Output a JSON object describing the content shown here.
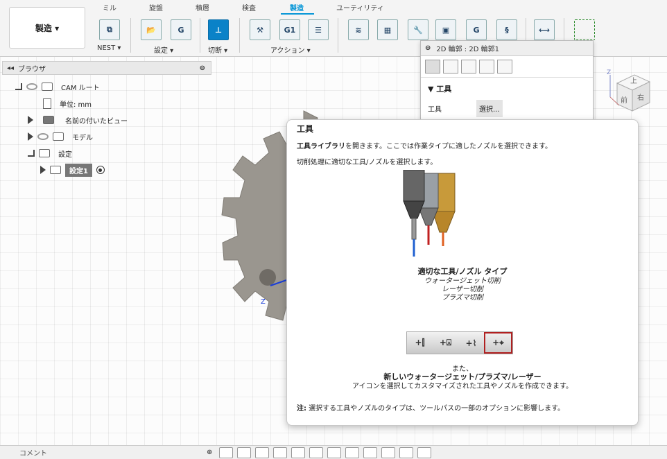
{
  "tabs": [
    "ミル",
    "旋盤",
    "積層",
    "検査",
    "製造",
    "ユーティリティ"
  ],
  "active_tab": "製造",
  "workspace_button": "製造 ▾",
  "toolbar_groups": {
    "nest": "NEST ▾",
    "setup": "設定 ▾",
    "cut": "切断 ▾",
    "action": "アクション ▾"
  },
  "browser": {
    "title": "ブラウザ",
    "items": {
      "cam_root": "CAM ルート",
      "units": "単位: mm",
      "named_views": "名前の付いたビュー",
      "model": "モデル",
      "setups": "設定",
      "setup1": "設定1"
    }
  },
  "dialog": {
    "title": "2D 輪郭 : 2D 輪郭1",
    "section": "工具",
    "tool_label": "工具",
    "select_button": "選択..."
  },
  "tooltip": {
    "title": "工具",
    "line1_bold": "工具ライブラリ",
    "line1_rest": "を開きます。ここでは作業タイプに適したノズルを選択できます。",
    "line2": "切削処理に適切な工具/ノズルを選択します。",
    "types_title": "適切な工具/ノズル タイプ",
    "types": [
      "ウォータージェット切削",
      "レーザー切削",
      "プラズマ切削"
    ],
    "also": "また、",
    "new_bold": "新しいウォータージェット/プラズマ/レーザー",
    "new_rest": "アイコンを選択してカスタマイズされた工具やノズルを作成できます。",
    "note_bold": "注:",
    "note_rest": " 選択する工具やノズルのタイプは、ツールパスの一部のオプションに影響します。"
  },
  "navcube": {
    "front": "前",
    "right": "右",
    "top": "上"
  },
  "axis_label": "Z",
  "status": {
    "comment": "コメント"
  },
  "colors": {
    "accent": "#0696d7",
    "highlight_border": "#b02020"
  }
}
